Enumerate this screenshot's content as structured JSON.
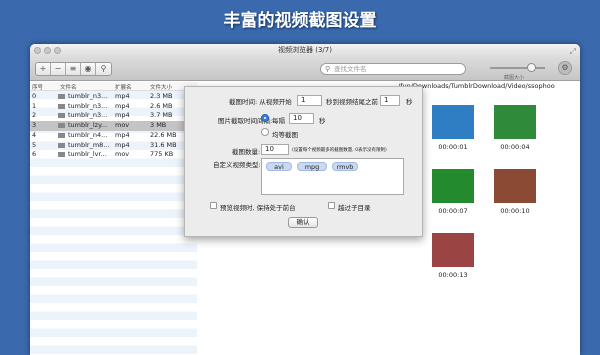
{
  "banner": "丰富的视频截图设置",
  "window": {
    "title": "视频浏览器 (3/7)"
  },
  "toolbar": {
    "search_placeholder": "查找文件名",
    "slider_label": "截图大小"
  },
  "list": {
    "headers": [
      "序号",
      "文件名",
      "扩展名",
      "文件大小"
    ],
    "rows": [
      {
        "idx": "0",
        "name": "tumblr_n3...",
        "ext": "mp4",
        "size": "2.3 MB"
      },
      {
        "idx": "1",
        "name": "tumblr_n3...",
        "ext": "mp4",
        "size": "2.6 MB"
      },
      {
        "idx": "2",
        "name": "tumblr_n3...",
        "ext": "mp4",
        "size": "3.7 MB"
      },
      {
        "idx": "3",
        "name": "tumblr_lzy...",
        "ext": "mov",
        "size": "3 MB"
      },
      {
        "idx": "4",
        "name": "tumblr_n4...",
        "ext": "mp4",
        "size": "22.6 MB"
      },
      {
        "idx": "5",
        "name": "tumblr_m8...",
        "ext": "mp4",
        "size": "31.6 MB"
      },
      {
        "idx": "6",
        "name": "tumblr_lvr...",
        "ext": "mov",
        "size": "775 KB"
      }
    ]
  },
  "preview": {
    "path": "/fun/Downloads/TumblrDownload/Video/ssophoo",
    "thumbs": [
      {
        "time": "00:00:01",
        "color": "#2f7ec4"
      },
      {
        "time": "00:00:04",
        "color": "#2f8a3a"
      },
      {
        "time": "00:00:07",
        "color": "#238a2e"
      },
      {
        "time": "00:00:10",
        "color": "#8a4a34"
      },
      {
        "time": "00:00:13",
        "color": "#9a4444"
      }
    ]
  },
  "dialog": {
    "start_label": "截图时间: 从视频开始",
    "start_value": "1",
    "end_label": "秒到视频结尾之前",
    "end_value": "1",
    "sec": "秒",
    "interval_label": "图片截取时间间隔:",
    "every_label": "每隔",
    "every_value": "10",
    "even_label": "均等截图",
    "count_label": "截图数量:",
    "count_value": "10",
    "count_hint": "(设置每个视频最多的截图数量, 0表示没有限制)",
    "types_label": "自定义视频类型:",
    "types": [
      "avi",
      "mpg",
      "rmvb"
    ],
    "front_label": "预览视频时, 保持处于前台",
    "skip_label": "越过子目录",
    "ok_label": "确认"
  }
}
